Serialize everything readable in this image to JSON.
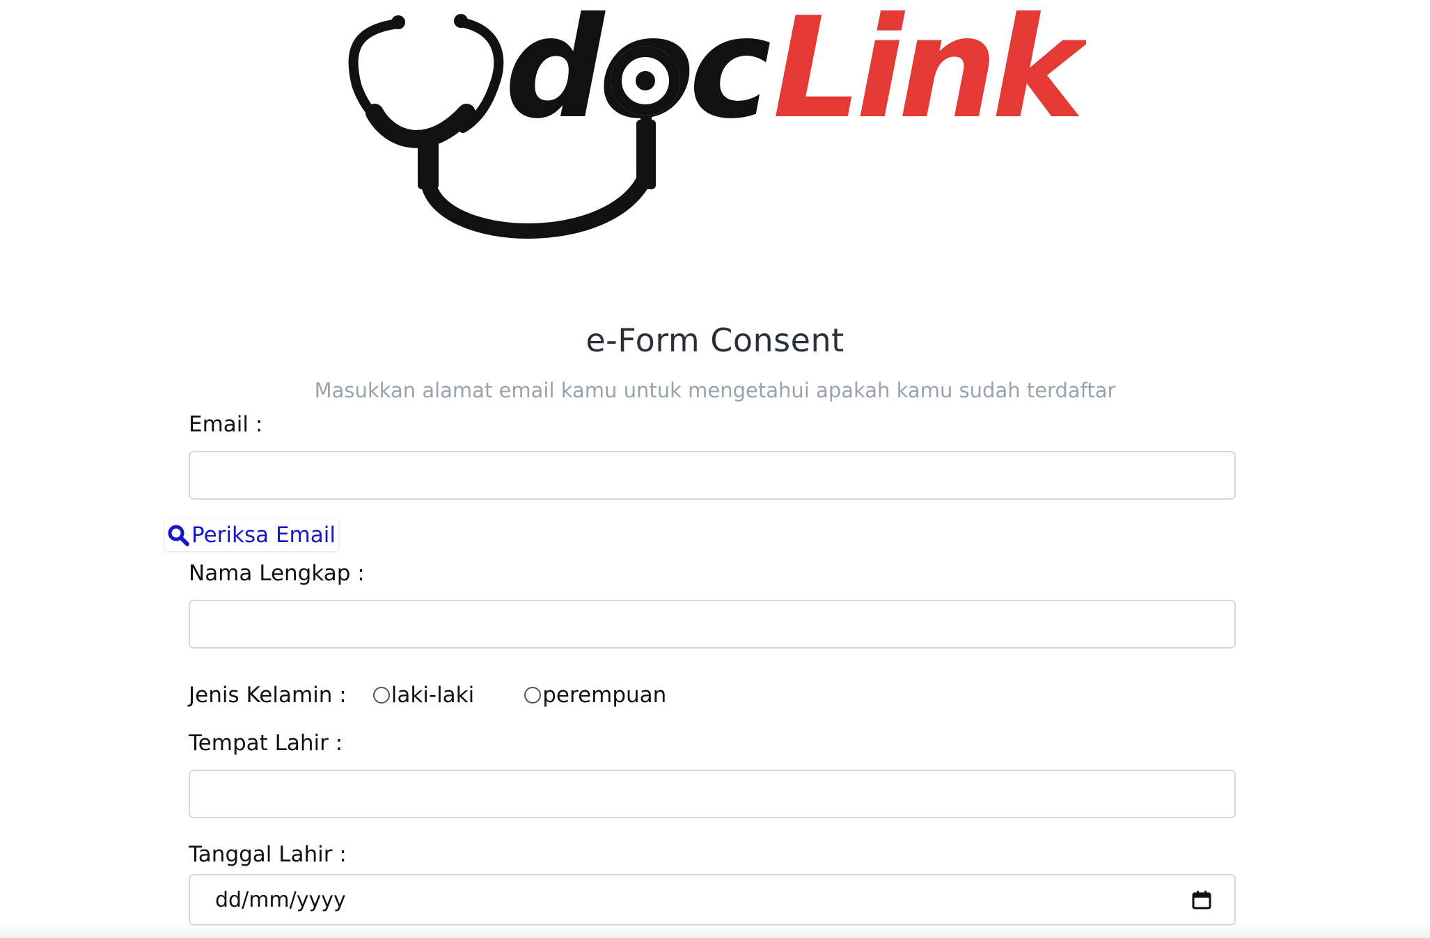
{
  "logo": {
    "part1": "doc",
    "part2": "Link",
    "color_dark": "#111111",
    "color_accent": "#e53935"
  },
  "form": {
    "title": "e-Form Consent",
    "subtitle": "Masukkan alamat email kamu untuk mengetahui apakah kamu sudah terdaftar",
    "email_label": "Email :",
    "email_value": "",
    "check_email_label": "Periksa Email",
    "check_email_icon": "search-icon",
    "fullname_label": "Nama Lengkap :",
    "fullname_value": "",
    "gender_label": "Jenis Kelamin :",
    "gender_options": [
      "laki-laki",
      "perempuan"
    ],
    "birthplace_label": "Tempat Lahir :",
    "birthplace_value": "",
    "birthdate_label": "Tanggal Lahir :",
    "birthdate_placeholder": "dd/mm/yyyy",
    "birthdate_icon": "calendar-icon"
  },
  "colors": {
    "link": "#1717c8",
    "subtitle": "#9ba2ab",
    "title": "#2b2f3a",
    "field_border": "#d6d8db"
  }
}
